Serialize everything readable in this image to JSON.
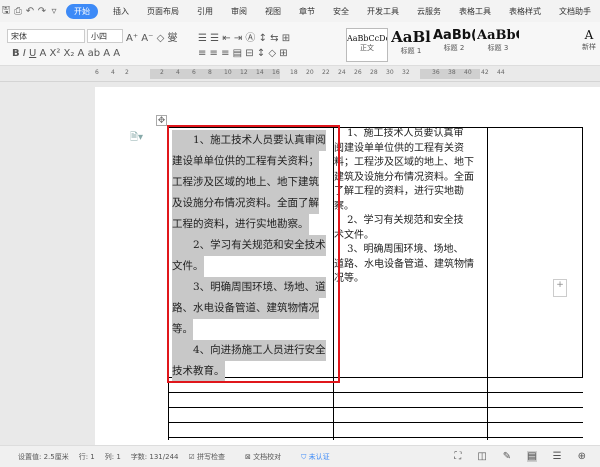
{
  "menu": {
    "tabs": [
      "开始",
      "插入",
      "页面布局",
      "引用",
      "审阅",
      "视图",
      "章节",
      "安全",
      "开发工具",
      "云服务",
      "表格工具",
      "表格样式",
      "文档助手"
    ]
  },
  "toolbar": {
    "font": "宋体",
    "size": "小四",
    "styles": [
      {
        "preview": "AaBbCcDc",
        "label": "正文"
      },
      {
        "preview": "AaBl",
        "label": "标题 1"
      },
      {
        "preview": "AaBb(",
        "label": "标题 2"
      },
      {
        "preview": "AaBbC",
        "label": "标题 3"
      }
    ],
    "new_style": "新样"
  },
  "ruler": {
    "ticks": [
      "6",
      "4",
      "2",
      "2",
      "4",
      "6",
      "8",
      "10",
      "12",
      "14",
      "16",
      "18",
      "20",
      "22",
      "24",
      "26",
      "28",
      "30",
      "32",
      "36",
      "38",
      "40",
      "42",
      "44"
    ]
  },
  "document": {
    "left_lines": [
      "　　1、施工技术人员要认真审阅",
      "建设单单位供的工程有关资料；",
      "工程涉及区域的地上、地下建筑",
      "及设施分布情况资料。全面了解",
      "工程的资料，进行实地勘察。",
      "　　2、学习有关规范和安全技术",
      "文件。",
      "　　3、明确周围环境、场地、道",
      "路、水电设备管道、建筑物情况",
      "等。",
      "　　4、向进扬施工人员进行安全",
      "技术教育。"
    ],
    "mid_lines": [
      "　 1、施工技术人员要认真审",
      "阅建设单单位供的工程有关资",
      "料；工程涉及区域的地上、地下",
      "建筑及设施分布情况资料。全面",
      "了解工程的资料，进行实地勘",
      "察。",
      "　 2、学习有关规范和安全技",
      "术文件。",
      "　 3、明确周围环境、场地、",
      "道路、水电设备管道、建筑物情",
      "况等。"
    ]
  },
  "status": {
    "setting": "设置值: 2.5厘米",
    "row": "行: 1",
    "col": "列: 1",
    "words": "字数: 131/244",
    "spell": "拼写检查",
    "proof": "文档校对",
    "cert": "未认证"
  },
  "colors": {
    "accent": "#3d8af7",
    "highlight": "#e0161b"
  }
}
